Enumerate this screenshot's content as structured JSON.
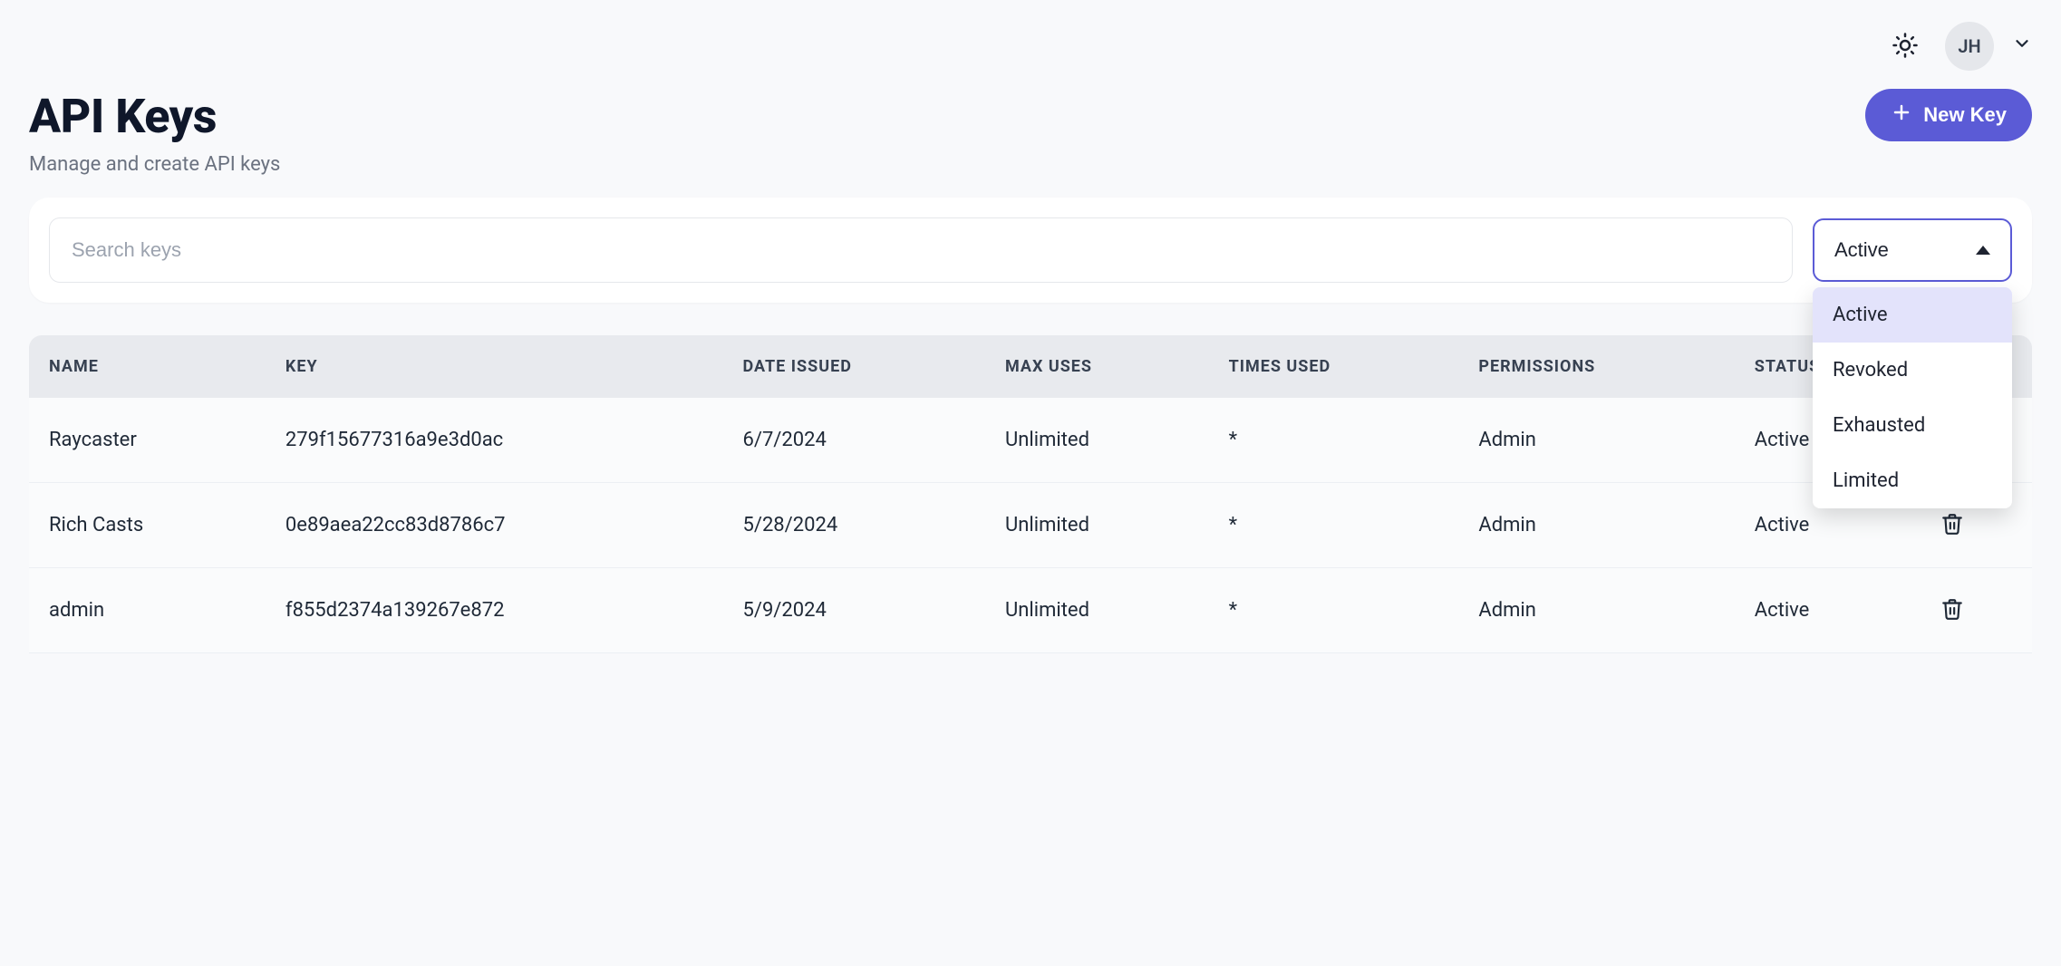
{
  "topbar": {
    "user_initials": "JH"
  },
  "page": {
    "title": "API Keys",
    "subtitle": "Manage and create API keys",
    "new_key_label": "New Key"
  },
  "search": {
    "placeholder": "Search keys"
  },
  "status_filter": {
    "selected": "Active",
    "options": [
      "Active",
      "Revoked",
      "Exhausted",
      "Limited"
    ]
  },
  "table": {
    "columns": [
      "NAME",
      "KEY",
      "DATE ISSUED",
      "MAX USES",
      "TIMES USED",
      "PERMISSIONS",
      "STATUS",
      ""
    ],
    "rows": [
      {
        "name": "Raycaster",
        "key": "279f15677316a9e3d0ac",
        "date": "6/7/2024",
        "max_uses": "Unlimited",
        "times_used": "*",
        "permissions": "Admin",
        "status": "Active"
      },
      {
        "name": "Rich Casts",
        "key": "0e89aea22cc83d8786c7",
        "date": "5/28/2024",
        "max_uses": "Unlimited",
        "times_used": "*",
        "permissions": "Admin",
        "status": "Active"
      },
      {
        "name": "admin",
        "key": "f855d2374a139267e872",
        "date": "5/9/2024",
        "max_uses": "Unlimited",
        "times_used": "*",
        "permissions": "Admin",
        "status": "Active"
      }
    ]
  }
}
